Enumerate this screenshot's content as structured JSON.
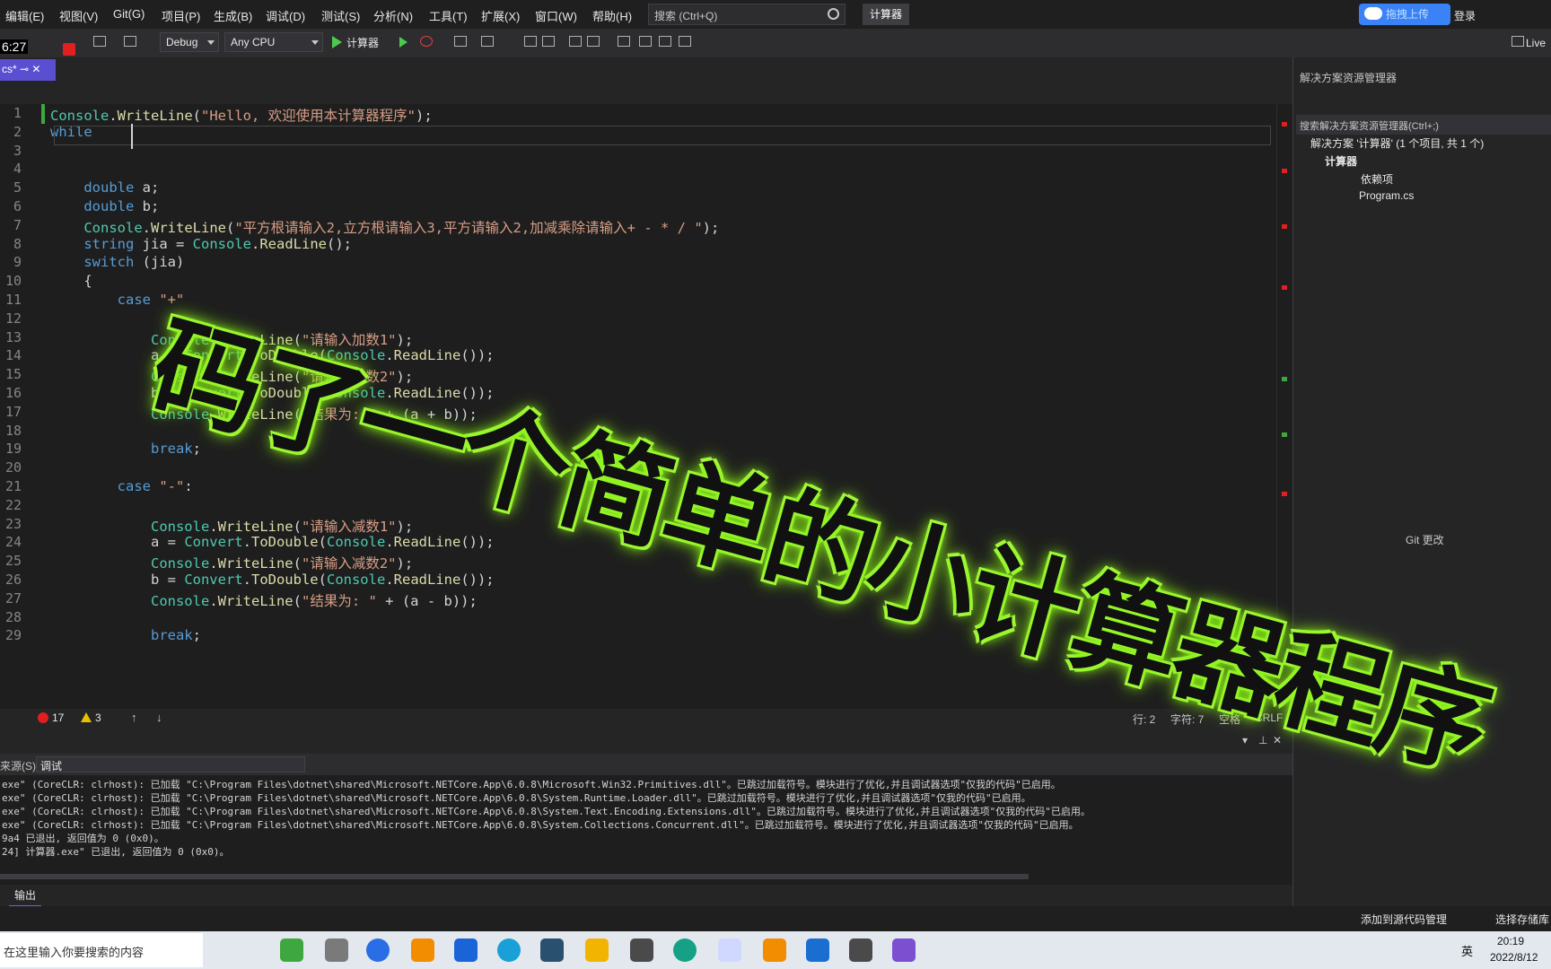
{
  "menu": [
    "编辑(E)",
    "视图(V)",
    "Git(G)",
    "项目(P)",
    "生成(B)",
    "调试(D)",
    "测试(S)",
    "分析(N)",
    "工具(T)",
    "扩展(X)",
    "窗口(W)",
    "帮助(H)"
  ],
  "search": {
    "placeholder": "搜索 (Ctrl+Q)"
  },
  "app_name": "计算器",
  "upload_label": "拖拽上传",
  "login_label": "登录",
  "toolbar": {
    "config": "Debug",
    "platform": "Any CPU",
    "run_label": "计算器",
    "live_label": "Live"
  },
  "recording": {
    "timer": "6:27"
  },
  "doc_tab": {
    "label": "cs*"
  },
  "code_lines": [
    {
      "n": "1",
      "text": "Console.WriteLine(\"Hello, 欢迎使用本计算器程序\");"
    },
    {
      "n": "2",
      "text": "while "
    },
    {
      "n": "3",
      "text": ""
    },
    {
      "n": "4",
      "text": ""
    },
    {
      "n": "5",
      "text": "    double a;"
    },
    {
      "n": "6",
      "text": "    double b;"
    },
    {
      "n": "7",
      "text": "    Console.WriteLine(\"平方根请输入2,立方根请输入3,平方请输入2,加减乘除请输入+ - * / \");"
    },
    {
      "n": "8",
      "text": "    string jia = Console.ReadLine();"
    },
    {
      "n": "9",
      "text": "    switch (jia)"
    },
    {
      "n": "10",
      "text": "    {"
    },
    {
      "n": "11",
      "text": "        case \"+\""
    },
    {
      "n": "12",
      "text": ""
    },
    {
      "n": "13",
      "text": "            Console.WriteLine(\"请输入加数1\");"
    },
    {
      "n": "14",
      "text": "            a = Convert.ToDouble(Console.ReadLine());"
    },
    {
      "n": "15",
      "text": "            Console.WriteLine(\"请输入加数2\");"
    },
    {
      "n": "16",
      "text": "            b = Convert.ToDouble(Console.ReadLine());"
    },
    {
      "n": "17",
      "text": "            Console.WriteLine(\"结果为: \" + (a + b));"
    },
    {
      "n": "18",
      "text": ""
    },
    {
      "n": "19",
      "text": "            break;"
    },
    {
      "n": "20",
      "text": ""
    },
    {
      "n": "21",
      "text": "        case \"-\":"
    },
    {
      "n": "22",
      "text": ""
    },
    {
      "n": "23",
      "text": "            Console.WriteLine(\"请输入减数1\");"
    },
    {
      "n": "24",
      "text": "            a = Convert.ToDouble(Console.ReadLine());"
    },
    {
      "n": "25",
      "text": "            Console.WriteLine(\"请输入减数2\");"
    },
    {
      "n": "26",
      "text": "            b = Convert.ToDouble(Console.ReadLine());"
    },
    {
      "n": "27",
      "text": "            Console.WriteLine(\"结果为: \" + (a - b));"
    },
    {
      "n": "28",
      "text": ""
    },
    {
      "n": "29",
      "text": "            break;"
    }
  ],
  "editor_status": {
    "errors": "17",
    "warnings": "3",
    "line": "行: 2",
    "col": "字符: 7",
    "spacing": "空格",
    "eol": "CRLF"
  },
  "output": {
    "source_label": "来源(S):",
    "source_value": "调试",
    "lines": [
      "exe\" (CoreCLR: clrhost): 已加载 \"C:\\Program Files\\dotnet\\shared\\Microsoft.NETCore.App\\6.0.8\\Microsoft.Win32.Primitives.dll\"。已跳过加载符号。模块进行了优化,并且调试器选项\"仅我的代码\"已启用。",
      "exe\" (CoreCLR: clrhost): 已加载 \"C:\\Program Files\\dotnet\\shared\\Microsoft.NETCore.App\\6.0.8\\System.Runtime.Loader.dll\"。已跳过加载符号。模块进行了优化,并且调试器选项\"仅我的代码\"已启用。",
      "exe\" (CoreCLR: clrhost): 已加载 \"C:\\Program Files\\dotnet\\shared\\Microsoft.NETCore.App\\6.0.8\\System.Text.Encoding.Extensions.dll\"。已跳过加载符号。模块进行了优化,并且调试器选项\"仅我的代码\"已启用。",
      "exe\" (CoreCLR: clrhost): 已加载 \"C:\\Program Files\\dotnet\\shared\\Microsoft.NETCore.App\\6.0.8\\System.Collections.Concurrent.dll\"。已跳过加载符号。模块进行了优化,并且调试器选项\"仅我的代码\"已启用。",
      "9a4 已退出, 返回值为 0 (0x0)。",
      "24] 计算器.exe\" 已退出, 返回值为 0 (0x0)。"
    ],
    "tab_label": "输出"
  },
  "solution": {
    "title": "解决方案资源管理器",
    "search_placeholder": "搜索解决方案资源管理器(Ctrl+;)",
    "items": [
      "解决方案 '计算器' (1 个项目, 共 1 个)",
      "计算器",
      "依赖项",
      "Program.cs"
    ],
    "git_label": "Git 更改"
  },
  "statusbar": {
    "add_source": "添加到源代码管理",
    "select_repo": "选择存储库"
  },
  "taskbar": {
    "search_placeholder": "在这里输入你要搜索的内容",
    "time": "20:19",
    "date": "2022/8/12",
    "ime": "英"
  },
  "overlay": {
    "title": "码了一个简单的小计算器程序"
  },
  "colors": {
    "accent": "#6e62d8",
    "highlight_glow": "#9cff30"
  }
}
